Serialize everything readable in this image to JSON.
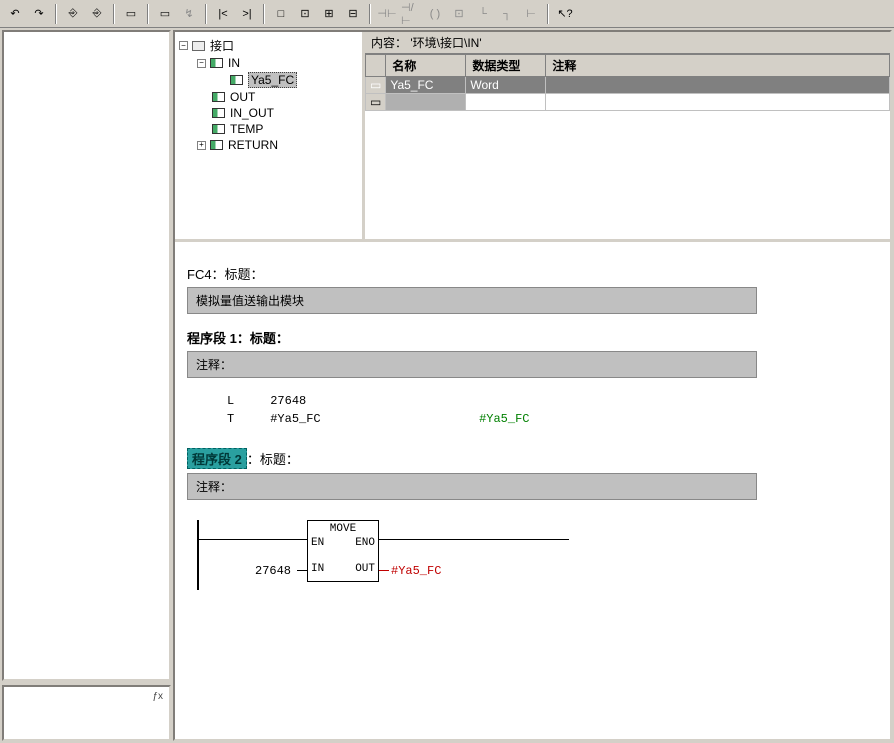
{
  "toolbar": {
    "undo": "↶",
    "redo": "↷",
    "t3": "⎆",
    "t4": "⎆",
    "t5": "▭",
    "t6": "▭",
    "t7": "↯",
    "t8": "|<",
    "t9": ">|",
    "t10": "□",
    "t11": "⊡",
    "t12": "⊞",
    "t13": "⊟",
    "t14": "⊣⊢",
    "t15": "⊣/⊢",
    "t16": "( )",
    "t17": "⊡",
    "t18": "└",
    "t19": "┐",
    "t20": "⊢",
    "t21": "↖?"
  },
  "tree": {
    "root": "接口",
    "in": "IN",
    "selected": "Ya5_FC",
    "out": "OUT",
    "inout": "IN_OUT",
    "temp": "TEMP",
    "return": "RETURN"
  },
  "grid": {
    "path_label": "内容：",
    "path_value": "'环境\\接口\\IN'",
    "col_name": "名称",
    "col_type": "数据类型",
    "col_comment": "注释",
    "row1_name": "Ya5_FC",
    "row1_type": "Word"
  },
  "code": {
    "fc_title": "FC4：标题：",
    "fc_comment": "模拟量值送输出模块",
    "seg1_label": "程序段 1：标题：",
    "seg1_comment": "注释：",
    "stl_l": "L",
    "stl_l_val": "27648",
    "stl_t": "T",
    "stl_t_val": "#Ya5_FC",
    "stl_t_comment": "#Ya5_FC",
    "seg2_label": "程序段 2",
    "seg2_rest": "：标题：",
    "seg2_comment": "注释：",
    "move_title": "MOVE",
    "en": "EN",
    "eno": "ENO",
    "in": "IN",
    "out": "OUT",
    "in_val": "27648",
    "out_val": "#Ya5_FC"
  },
  "misc": {
    "small": "ƒx"
  }
}
